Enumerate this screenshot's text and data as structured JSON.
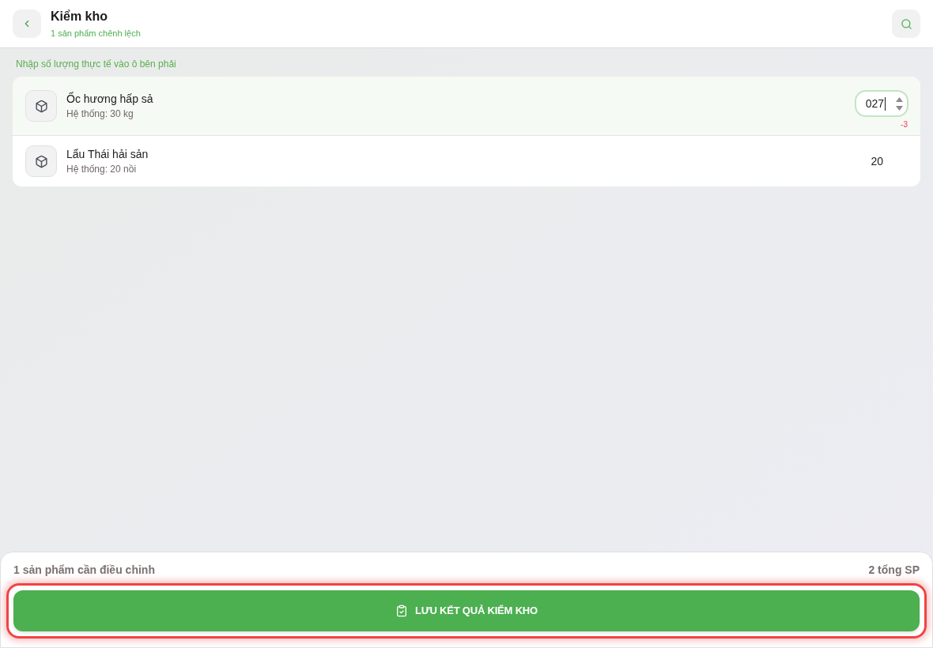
{
  "header": {
    "title": "Kiểm kho",
    "subtitle": "1 sản phẩm chênh lệch"
  },
  "hint": "Nhập số lượng thực tế vào ô bên phải",
  "items": [
    {
      "name": "Ốc hương hấp sả",
      "system_stock": "Hệ thống: 30 kg",
      "kind": "input",
      "value": "027",
      "difference": "-3"
    },
    {
      "name": "Lẩu Thái hải sản",
      "system_stock": "Hệ thống: 20 nồi",
      "kind": "text",
      "value": "20"
    }
  ],
  "footer": {
    "summary": "1 sản phẩm cần điều chỉnh",
    "total": "2 tổng SP",
    "save_button": {
      "label": "LƯU KẾT QUẢ KIỂM KHO",
      "highlighted": true
    }
  }
}
